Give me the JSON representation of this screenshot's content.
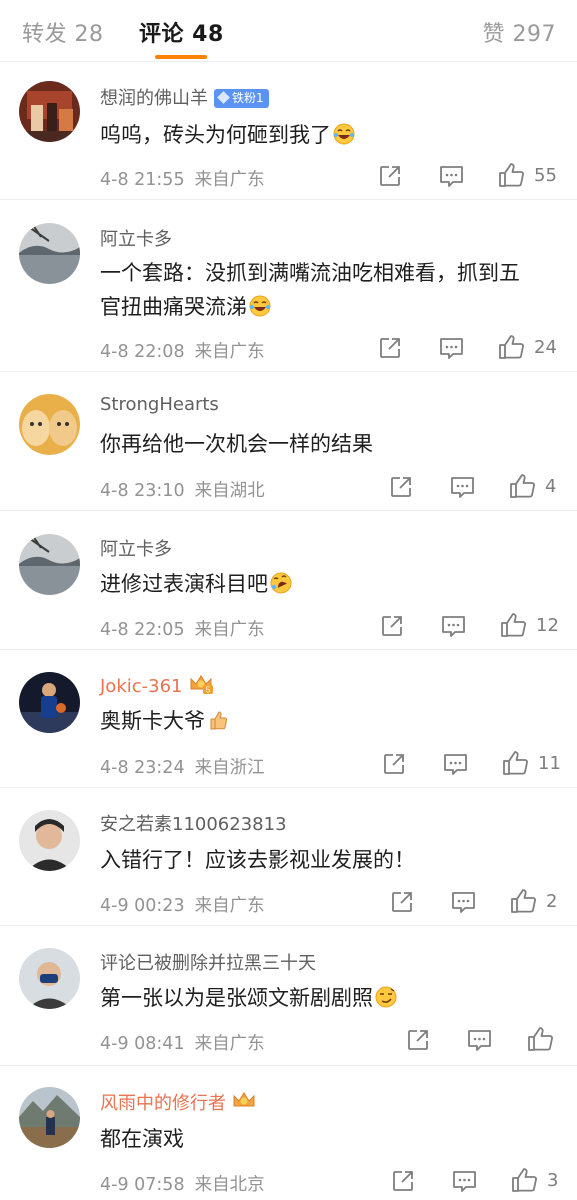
{
  "tabs": {
    "repost": "转发 28",
    "comment": "评论 48",
    "like": "赞 297"
  },
  "colors": {
    "accent": "#ff8200",
    "vip_name": "#eb7350",
    "fan_badge": "#5b93f5"
  },
  "icons": {
    "forward": "share-icon",
    "reply": "comment-icon",
    "like": "thumbs-up-icon"
  },
  "comments": [
    {
      "username": "想润的佛山羊",
      "badge": "铁粉1",
      "text": "呜呜，砖头为何砸到我了",
      "emoji": "laugh-cry-emoji",
      "date": "4-8 21:55",
      "source": "来自广东",
      "likes": "55"
    },
    {
      "username": "阿立卡多",
      "text": "一个套路：没抓到满嘴流油吃相难看，抓到五官扭曲痛哭流涕",
      "emoji": "laugh-cry-emoji",
      "date": "4-8 22:08",
      "source": "来自广东",
      "likes": "24"
    },
    {
      "username": "StrongHearts",
      "text": "你再给他一次机会一样的结果",
      "date": "4-8 23:10",
      "source": "来自湖北",
      "likes": "4"
    },
    {
      "username": "阿立卡多",
      "text": "进修过表演科目吧",
      "emoji": "rofl-emoji",
      "date": "4-8 22:05",
      "source": "来自广东",
      "likes": "12"
    },
    {
      "username": "Jokic-361",
      "vip": true,
      "text": "奥斯卡大爷",
      "emoji": "thumbs-up-emoji",
      "date": "4-8 23:24",
      "source": "来自浙江",
      "likes": "11"
    },
    {
      "username": "安之若素1100623813",
      "text": "入错行了！应该去影视业发展的！",
      "date": "4-9 00:23",
      "source": "来自广东",
      "likes": "2"
    },
    {
      "username": "评论已被删除并拉黑三十天",
      "text": "第一张以为是张颂文新剧剧照",
      "emoji": "smirk-emoji",
      "date": "4-9 08:41",
      "source": "来自广东",
      "likes": ""
    },
    {
      "username": "风雨中的修行者",
      "vip": true,
      "text": "都在演戏",
      "date": "4-9 07:58",
      "source": "来自北京",
      "likes": "3"
    }
  ]
}
